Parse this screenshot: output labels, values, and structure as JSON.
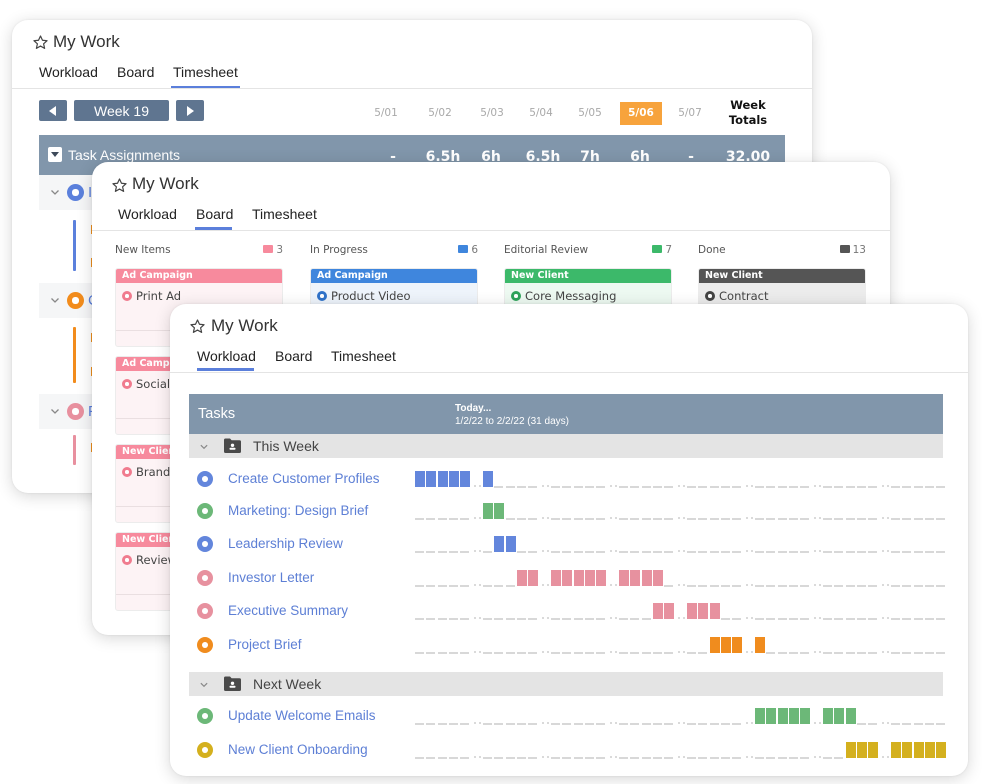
{
  "windows": {
    "timesheet": {
      "title": "My Work",
      "tabs": [
        {
          "label": "Workload"
        },
        {
          "label": "Board"
        },
        {
          "label": "Timesheet"
        }
      ],
      "active_tab": "Timesheet",
      "week_label": "Week 19",
      "dates": [
        "5/01",
        "5/02",
        "5/03",
        "5/04",
        "5/05",
        "5/06",
        "5/07"
      ],
      "today": "5/06",
      "totals_header": [
        "Week",
        "Totals"
      ],
      "section": {
        "label": "Task Assignments",
        "values": [
          "-",
          "6.5h",
          "6h",
          "6.5h",
          "7h",
          "6h",
          "-"
        ],
        "total": "32.00"
      },
      "groups": [
        {
          "label_fragment": "I",
          "color": "#5b80dc"
        },
        {
          "label_fragment": "C",
          "color": "#f28c1c"
        },
        {
          "label_fragment": "F",
          "color": "#e8909f"
        }
      ],
      "accent_color": "#f7a33c"
    },
    "board": {
      "title": "My Work",
      "tabs": [
        {
          "label": "Workload"
        },
        {
          "label": "Board"
        },
        {
          "label": "Timesheet"
        }
      ],
      "active_tab": "Board",
      "columns": [
        {
          "title": "New Items",
          "count": "3",
          "color": "#f78a9d",
          "tint": "#fdf3f5",
          "cards": [
            {
              "tag": "Ad Campaign",
              "task": "Print Ad"
            },
            {
              "tag": "Ad Campaign",
              "task": "Social M"
            },
            {
              "tag": "New Client",
              "task": "Brand"
            },
            {
              "tag": "New Client",
              "task": "Review"
            }
          ]
        },
        {
          "title": "In Progress",
          "count": "6",
          "color": "#3f86dd",
          "tint": "#eef4fb",
          "cards": [
            {
              "tag": "Ad Campaign",
              "task": "Product Video"
            }
          ]
        },
        {
          "title": "Editorial Review",
          "count": "7",
          "color": "#3cb96a",
          "tint": "#edf9f1",
          "cards": [
            {
              "tag": "New Client",
              "task": "Core Messaging"
            }
          ]
        },
        {
          "title": "Done",
          "count": "13",
          "color": "#555555",
          "tint": "#ececec",
          "cards": [
            {
              "tag": "New Client",
              "task": "Contract"
            }
          ]
        }
      ]
    },
    "workload": {
      "title": "My Work",
      "tabs": [
        {
          "label": "Workload"
        },
        {
          "label": "Board"
        },
        {
          "label": "Timesheet"
        }
      ],
      "active_tab": "Workload",
      "header": {
        "tasks_label": "Tasks",
        "today_label": "Today...",
        "range": "1/2/22 to 2/2/22 (31 days)"
      },
      "timeline": {
        "weeks_visible": 8,
        "weekdays_per_week": 5
      },
      "groups": [
        {
          "label": "This Week",
          "tasks": [
            {
              "name": "Create Customer Profiles",
              "color": "#6386dc",
              "active_weekdays": [
                0,
                1,
                2,
                3,
                4,
                5
              ]
            },
            {
              "name": "Marketing: Design Brief",
              "color": "#6cb878",
              "active_weekdays": [
                5,
                6
              ]
            },
            {
              "name": "Leadership Review",
              "color": "#6386dc",
              "active_weekdays": [
                6,
                7
              ]
            },
            {
              "name": "Investor Letter",
              "color": "#e7919f",
              "active_weekdays": [
                8,
                9,
                10,
                11,
                12,
                13,
                14,
                15,
                16,
                17,
                18
              ]
            },
            {
              "name": "Executive Summary",
              "color": "#e7919f",
              "active_weekdays": [
                18,
                19,
                20,
                21,
                22
              ]
            },
            {
              "name": "Project Brief",
              "color": "#f08c1e",
              "active_weekdays": [
                22,
                23,
                24,
                25
              ]
            }
          ]
        },
        {
          "label": "Next Week",
          "tasks": [
            {
              "name": "Update Welcome Emails",
              "color": "#6cb878",
              "active_weekdays": [
                25,
                26,
                27,
                28,
                29,
                30,
                31,
                32
              ]
            },
            {
              "name": "New Client Onboarding",
              "color": "#d4b01e",
              "active_weekdays": [
                32,
                33,
                34,
                35,
                36,
                37,
                38,
                39
              ]
            }
          ]
        }
      ]
    }
  }
}
